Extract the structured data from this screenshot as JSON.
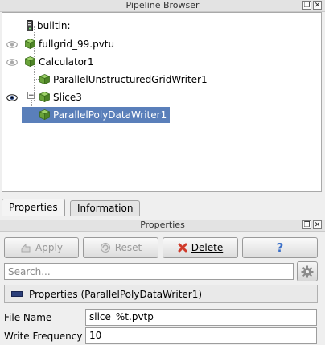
{
  "pipeline_browser": {
    "title": "Pipeline Browser",
    "items": [
      {
        "label": "builtin:"
      },
      {
        "label": "fullgrid_99.pvtu"
      },
      {
        "label": "Calculator1"
      },
      {
        "label": "ParallelUnstructuredGridWriter1"
      },
      {
        "label": "Slice3"
      },
      {
        "label": "ParallelPolyDataWriter1"
      }
    ]
  },
  "tabs": [
    {
      "label": "Properties",
      "active": true
    },
    {
      "label": "Information",
      "active": false
    }
  ],
  "properties_panel": {
    "title": "Properties",
    "buttons": {
      "apply": "Apply",
      "reset": "Reset",
      "delete": "Delete",
      "help": "?"
    },
    "search_placeholder": "Search...",
    "section_header": "Properties (ParallelPolyDataWriter1)",
    "fields": [
      {
        "label": "File Name",
        "value": "slice_%t.pvtp"
      },
      {
        "label": "Write Frequency",
        "value": "10"
      }
    ]
  },
  "colors": {
    "selection": "#5a7fba",
    "cube_green": "#6aa33a",
    "delete_red": "#d03a2a",
    "help_blue": "#3a6fc8"
  }
}
